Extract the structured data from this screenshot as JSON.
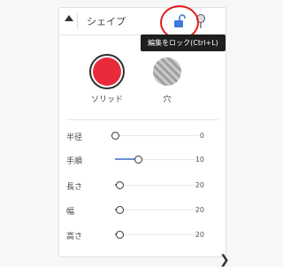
{
  "header": {
    "title": "シェイプ",
    "tooltip": "編集をロック(Ctrl+L)",
    "icons": [
      "collapse-arrow-icon",
      "unlock-icon",
      "pin-icon"
    ],
    "highlight_color": "#e41c1c"
  },
  "fill_options": [
    {
      "label": "ソリッド",
      "selected": true,
      "color": "#e82a3b"
    },
    {
      "label": "穴",
      "selected": false
    }
  ],
  "sliders": [
    {
      "label": "半径",
      "value": "0",
      "fraction": 0.0
    },
    {
      "label": "手順",
      "value": "10",
      "fraction": 0.28
    },
    {
      "label": "長さ",
      "value": "20",
      "fraction": 0.05
    },
    {
      "label": "幅",
      "value": "20",
      "fraction": 0.05
    },
    {
      "label": "高さ",
      "value": "20",
      "fraction": 0.05
    }
  ],
  "colors": {
    "accent": "#6a8fd6",
    "lock_icon": "#3c7be0"
  }
}
